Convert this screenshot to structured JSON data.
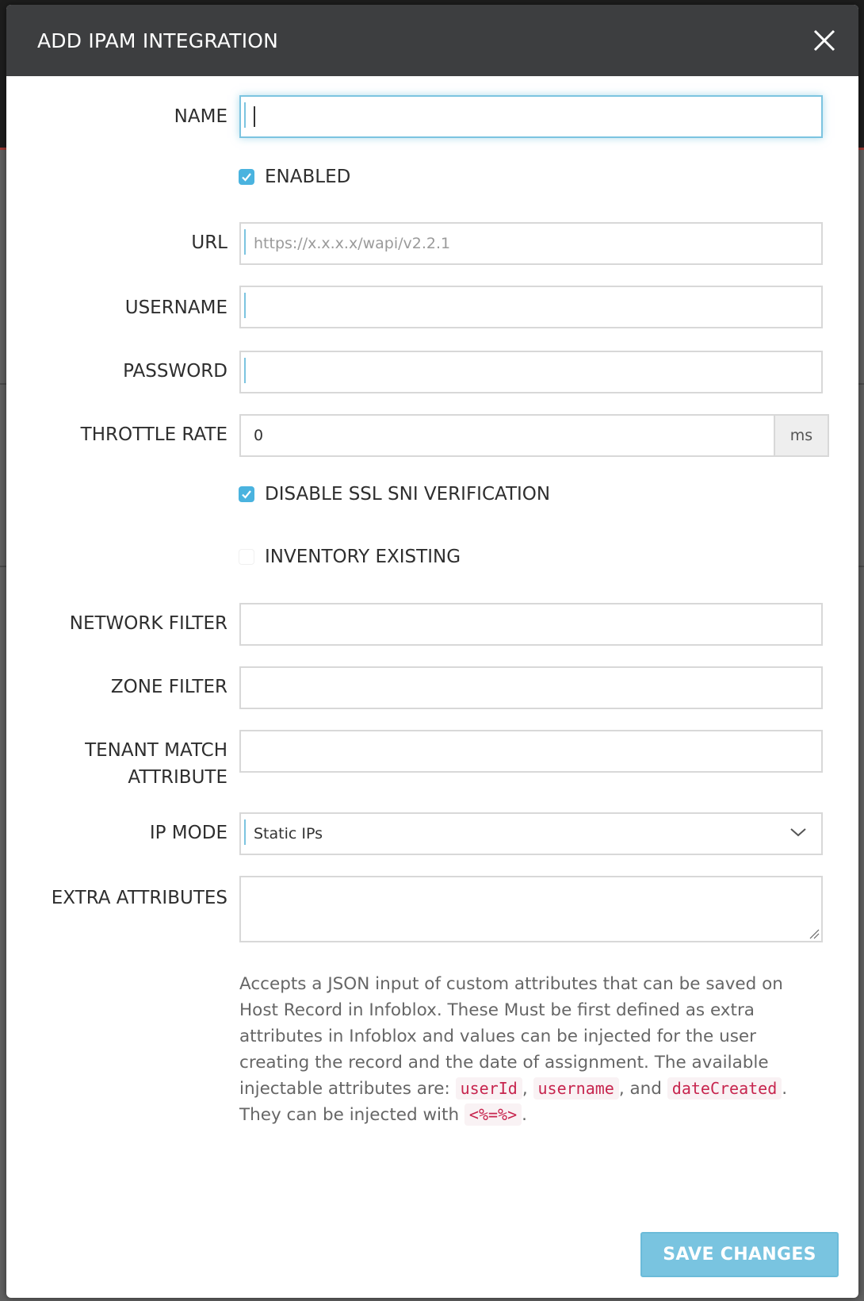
{
  "modal": {
    "title": "ADD IPAM INTEGRATION",
    "close_icon": "close-x-icon"
  },
  "form": {
    "name": {
      "label": "NAME",
      "value": ""
    },
    "enabled": {
      "label": "ENABLED",
      "checked": true
    },
    "url": {
      "label": "URL",
      "value": "",
      "placeholder": "https://x.x.x.x/wapi/v2.2.1"
    },
    "username": {
      "label": "USERNAME",
      "value": ""
    },
    "password": {
      "label": "PASSWORD",
      "value": ""
    },
    "throttle_rate": {
      "label": "THROTTLE RATE",
      "value": "0",
      "unit": "ms"
    },
    "disable_ssl_sni": {
      "label": "DISABLE SSL SNI VERIFICATION",
      "checked": true
    },
    "inventory_existing": {
      "label": "INVENTORY EXISTING",
      "checked": false
    },
    "network_filter": {
      "label": "NETWORK FILTER",
      "value": ""
    },
    "zone_filter": {
      "label": "ZONE FILTER",
      "value": ""
    },
    "tenant_match_attribute": {
      "label_line1": "TENANT MATCH",
      "label_line2": "ATTRIBUTE",
      "value": ""
    },
    "ip_mode": {
      "label": "IP MODE",
      "selected": "Static IPs"
    },
    "extra_attributes": {
      "label": "EXTRA ATTRIBUTES",
      "value": "",
      "help": {
        "part1": "Accepts a JSON input of custom attributes that can be saved on Host Record in Infoblox. These Must be first defined as extra attributes in Infoblox and values can be injected for the user creating the record and the date of assignment. The available injectable attributes are: ",
        "code1": "userId",
        "sep1": ", ",
        "code2": "username",
        "sep2": ", and ",
        "code3": "dateCreated",
        "part2": ". They can be injected with ",
        "code4": "<%=%>",
        "part3": "."
      }
    }
  },
  "actions": {
    "save_label": "SAVE CHANGES"
  },
  "colors": {
    "header_bg": "#3d3e40",
    "accent": "#4ab3df",
    "save_button": "#79c4e0",
    "code_text": "#c7254e"
  }
}
